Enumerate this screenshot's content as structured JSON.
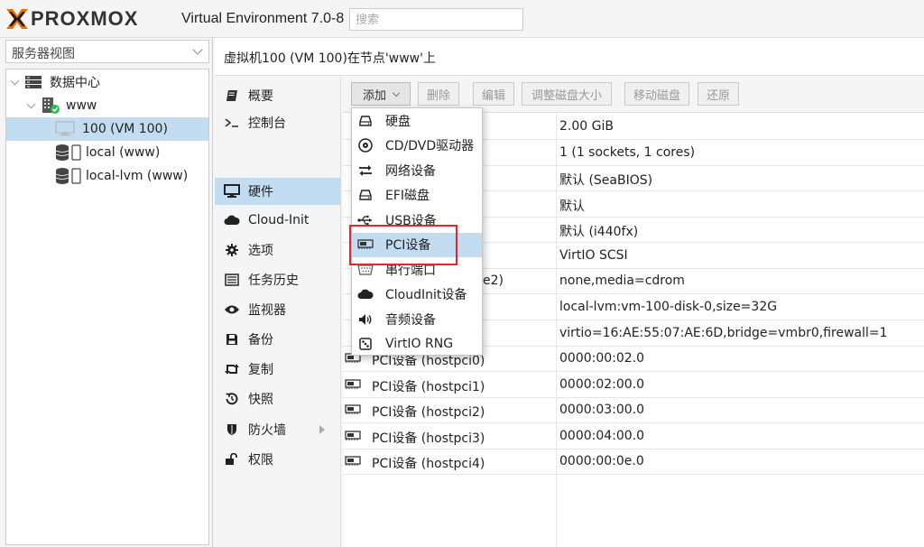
{
  "header": {
    "logo_text": "PROXMOX",
    "product": "Virtual Environment 7.0-8",
    "search_placeholder": "搜索"
  },
  "left": {
    "view_select": "服务器视图",
    "tree": [
      {
        "label": "数据中心",
        "icon": "datacenter-icon"
      },
      {
        "label": "www",
        "icon": "node-online-icon"
      },
      {
        "label": "100 (VM 100)",
        "icon": "vm-monitor-icon",
        "selected": true
      },
      {
        "label": "local (www)",
        "icon": "storage-icon"
      },
      {
        "label": "local-lvm (www)",
        "icon": "storage-icon"
      }
    ]
  },
  "content": {
    "title": "虚拟机100 (VM 100)在节点'www'上",
    "nav": [
      {
        "label": "概要",
        "icon": "book-icon"
      },
      {
        "label": "控制台",
        "icon": "terminal-icon"
      },
      {
        "label": "硬件",
        "icon": "desktop-icon",
        "active": true
      },
      {
        "label": "Cloud-Init",
        "icon": "cloud-icon"
      },
      {
        "label": "选项",
        "icon": "gear-icon"
      },
      {
        "label": "任务历史",
        "icon": "list-icon"
      },
      {
        "label": "监视器",
        "icon": "eye-icon"
      },
      {
        "label": "备份",
        "icon": "floppy-icon"
      },
      {
        "label": "复制",
        "icon": "retweet-icon"
      },
      {
        "label": "快照",
        "icon": "history-icon"
      },
      {
        "label": "防火墙",
        "icon": "shield-icon",
        "has_arrow": true
      },
      {
        "label": "权限",
        "icon": "unlock-icon"
      }
    ],
    "toolbar": {
      "add": "添加",
      "remove": "删除",
      "edit": "编辑",
      "resize": "调整磁盘大小",
      "move": "移动磁盘",
      "revert": "还原"
    },
    "rows": [
      {
        "name": "",
        "value": "2.00 GiB"
      },
      {
        "name": "",
        "value": "1 (1 sockets, 1 cores)"
      },
      {
        "name": "",
        "value": "默认 (SeaBIOS)"
      },
      {
        "name": "",
        "value": "默认"
      },
      {
        "name": "",
        "value": "默认 (i440fx)"
      },
      {
        "name": "",
        "value": "VirtIO SCSI"
      },
      {
        "name": "e2)",
        "value": "none,media=cdrom"
      },
      {
        "name": "",
        "value": "local-lvm:vm-100-disk-0,size=32G"
      },
      {
        "name": "",
        "value": "virtio=16:AE:55:07:AE:6D,bridge=vmbr0,firewall=1"
      },
      {
        "name": "PCI设备 (hostpci0)",
        "value": "0000:00:02.0"
      },
      {
        "name": "PCI设备 (hostpci1)",
        "value": "0000:02:00.0"
      },
      {
        "name": "PCI设备 (hostpci2)",
        "value": "0000:03:00.0"
      },
      {
        "name": "PCI设备 (hostpci3)",
        "value": "0000:04:00.0"
      },
      {
        "name": "PCI设备 (hostpci4)",
        "value": "0000:00:0e.0"
      }
    ]
  },
  "add_menu": [
    {
      "label": "硬盘",
      "icon": "hdd-icon"
    },
    {
      "label": "CD/DVD驱动器",
      "icon": "cdrom-icon"
    },
    {
      "label": "网络设备",
      "icon": "exchange-icon"
    },
    {
      "label": "EFI磁盘",
      "icon": "hdd-icon"
    },
    {
      "label": "USB设备",
      "icon": "usb-icon"
    },
    {
      "label": "PCI设备",
      "icon": "pci-card-icon",
      "hover": true
    },
    {
      "label": "串行端口",
      "icon": "serial-port-icon"
    },
    {
      "label": "CloudInit设备",
      "icon": "cloud-icon"
    },
    {
      "label": "音频设备",
      "icon": "volume-icon"
    },
    {
      "label": "VirtIO RNG",
      "icon": "dice-icon"
    }
  ]
}
